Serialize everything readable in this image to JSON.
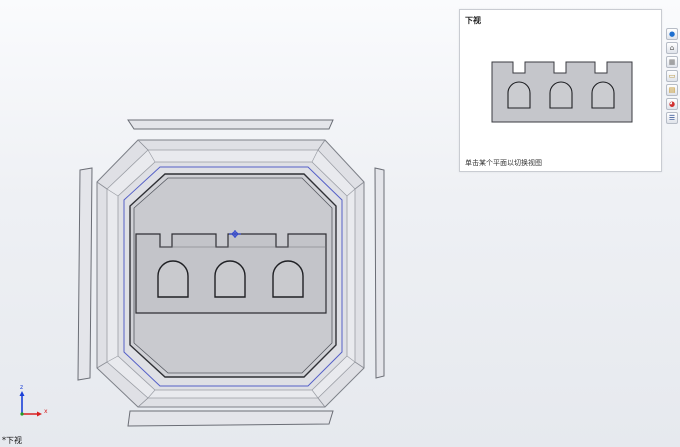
{
  "preview": {
    "title": "下视",
    "hint": "单击某个平面以切换视图"
  },
  "view_label": "*下视",
  "axes": {
    "z": "z",
    "x": "x"
  },
  "toolbar": [
    {
      "icon": "globe-icon",
      "glyph": "●"
    },
    {
      "icon": "home-icon",
      "glyph": "⌂"
    },
    {
      "icon": "parts-icon",
      "glyph": "▦"
    },
    {
      "icon": "folder-icon",
      "glyph": "▭"
    },
    {
      "icon": "tasks-icon",
      "glyph": "▤"
    },
    {
      "icon": "appearance-icon",
      "glyph": "◕"
    },
    {
      "icon": "properties-icon",
      "glyph": "☰"
    }
  ],
  "colors": {
    "part_fill": "#c6c7cc",
    "part_edge": "#3a3b40",
    "mold_edge": "#8a8d95",
    "sketch_blue": "#5560c8"
  }
}
